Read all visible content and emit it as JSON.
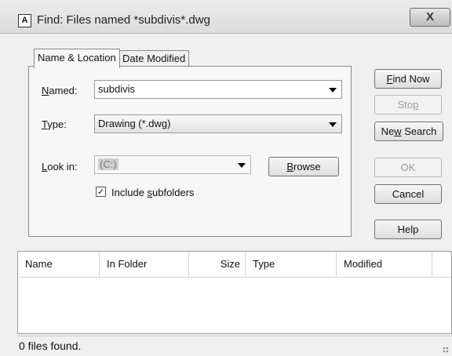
{
  "window": {
    "icon_letter": "A",
    "title": "Find: Files named *subdivis*.dwg",
    "close_glyph": "X"
  },
  "tabs": [
    {
      "label": "Name & Location",
      "active": true
    },
    {
      "label": "Date Modified",
      "active": false
    }
  ],
  "form": {
    "named": {
      "label_pre": "",
      "label_key": "N",
      "label_post": "amed:",
      "value": "subdivis"
    },
    "type": {
      "label_pre": "",
      "label_key": "T",
      "label_post": "ype:",
      "value": "Drawing (*.dwg)"
    },
    "lookin": {
      "label_pre": "",
      "label_key": "L",
      "label_post": "ook in:",
      "value": "(C:)"
    },
    "browse": {
      "pre": "",
      "key": "B",
      "post": "rowse"
    },
    "include_subfolders": {
      "checked": true,
      "check_glyph": "✓",
      "pre": "Include ",
      "key": "s",
      "post": "ubfolders"
    }
  },
  "buttons": {
    "find_now": {
      "pre": "",
      "key": "F",
      "post": "ind Now",
      "enabled": true
    },
    "stop": {
      "pre": "Sto",
      "key": "p",
      "post": "",
      "enabled": false
    },
    "new_search": {
      "pre": "Ne",
      "key": "w",
      "post": " Search",
      "enabled": true
    },
    "ok": {
      "label": "OK",
      "enabled": false
    },
    "cancel": {
      "label": "Cancel",
      "enabled": true
    },
    "help": {
      "label": "Help",
      "enabled": true
    }
  },
  "results": {
    "columns": [
      "Name",
      "In Folder",
      "Size",
      "Type",
      "Modified"
    ],
    "rows": []
  },
  "status": {
    "text": "0 files found."
  }
}
